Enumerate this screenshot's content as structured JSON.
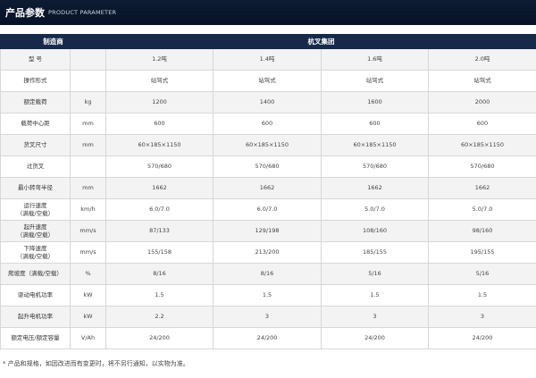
{
  "header": {
    "title_cn": "产品参数",
    "title_en": "PRODUCT PARAMETER"
  },
  "table": {
    "manufacturer_label": "制造商",
    "manufacturer_value": "杭叉集团",
    "rows": [
      {
        "label": "型 号",
        "unit": "",
        "values": [
          "1.2吨",
          "1.4吨",
          "1.6吨",
          "2.0吨"
        ]
      },
      {
        "label": "操作形式",
        "unit": "",
        "values": [
          "站驾式",
          "站驾式",
          "站驾式",
          "站驾式"
        ]
      },
      {
        "label": "额定载荷",
        "unit": "kg",
        "values": [
          "1200",
          "1400",
          "1600",
          "2000"
        ]
      },
      {
        "label": "载荷中心距",
        "unit": "mm",
        "values": [
          "600",
          "600",
          "600",
          "600"
        ]
      },
      {
        "label": "货叉尺寸",
        "unit": "mm",
        "values": [
          "60×185×1150",
          "60×185×1150",
          "60×185×1150",
          "60×185×1150"
        ]
      },
      {
        "label": "过货叉",
        "unit": "",
        "values": [
          "570/680",
          "570/680",
          "570/680",
          "570/680"
        ]
      },
      {
        "label": "最小转弯半径",
        "unit": "mm",
        "values": [
          "1662",
          "1662",
          "1662",
          "1662"
        ]
      },
      {
        "label": "运行速度",
        "label2": "（满载/空载）",
        "unit": "km/h",
        "values": [
          "6.0/7.0",
          "6.0/7.0",
          "5.0/7.0",
          "5.0/7.0"
        ]
      },
      {
        "label": "起升速度",
        "label2": "（满载/空载）",
        "unit": "mm/s",
        "values": [
          "87/133",
          "129/198",
          "108/160",
          "98/160"
        ]
      },
      {
        "label": "下降速度",
        "label2": "（满载/空载）",
        "unit": "mm/s",
        "values": [
          "155/158",
          "213/200",
          "185/155",
          "195/155"
        ]
      },
      {
        "label": "爬坡度（满载/空载）",
        "unit": "%",
        "values": [
          "8/16",
          "8/16",
          "5/16",
          "5/16"
        ]
      },
      {
        "label": "驱动电机功率",
        "unit": "kW",
        "values": [
          "1.5",
          "1.5",
          "1.5",
          "1.5"
        ]
      },
      {
        "label": "起升电机功率",
        "unit": "kW",
        "values": [
          "2.2",
          "3",
          "3",
          "3"
        ]
      },
      {
        "label": "额定电压/额定容量",
        "unit": "V/Ah",
        "values": [
          "24/200",
          "24/200",
          "24/200",
          "24/200"
        ]
      }
    ]
  },
  "footnote": "* 产品和规格，如因改进而有变更时，将不另行通知，以实物为准。"
}
